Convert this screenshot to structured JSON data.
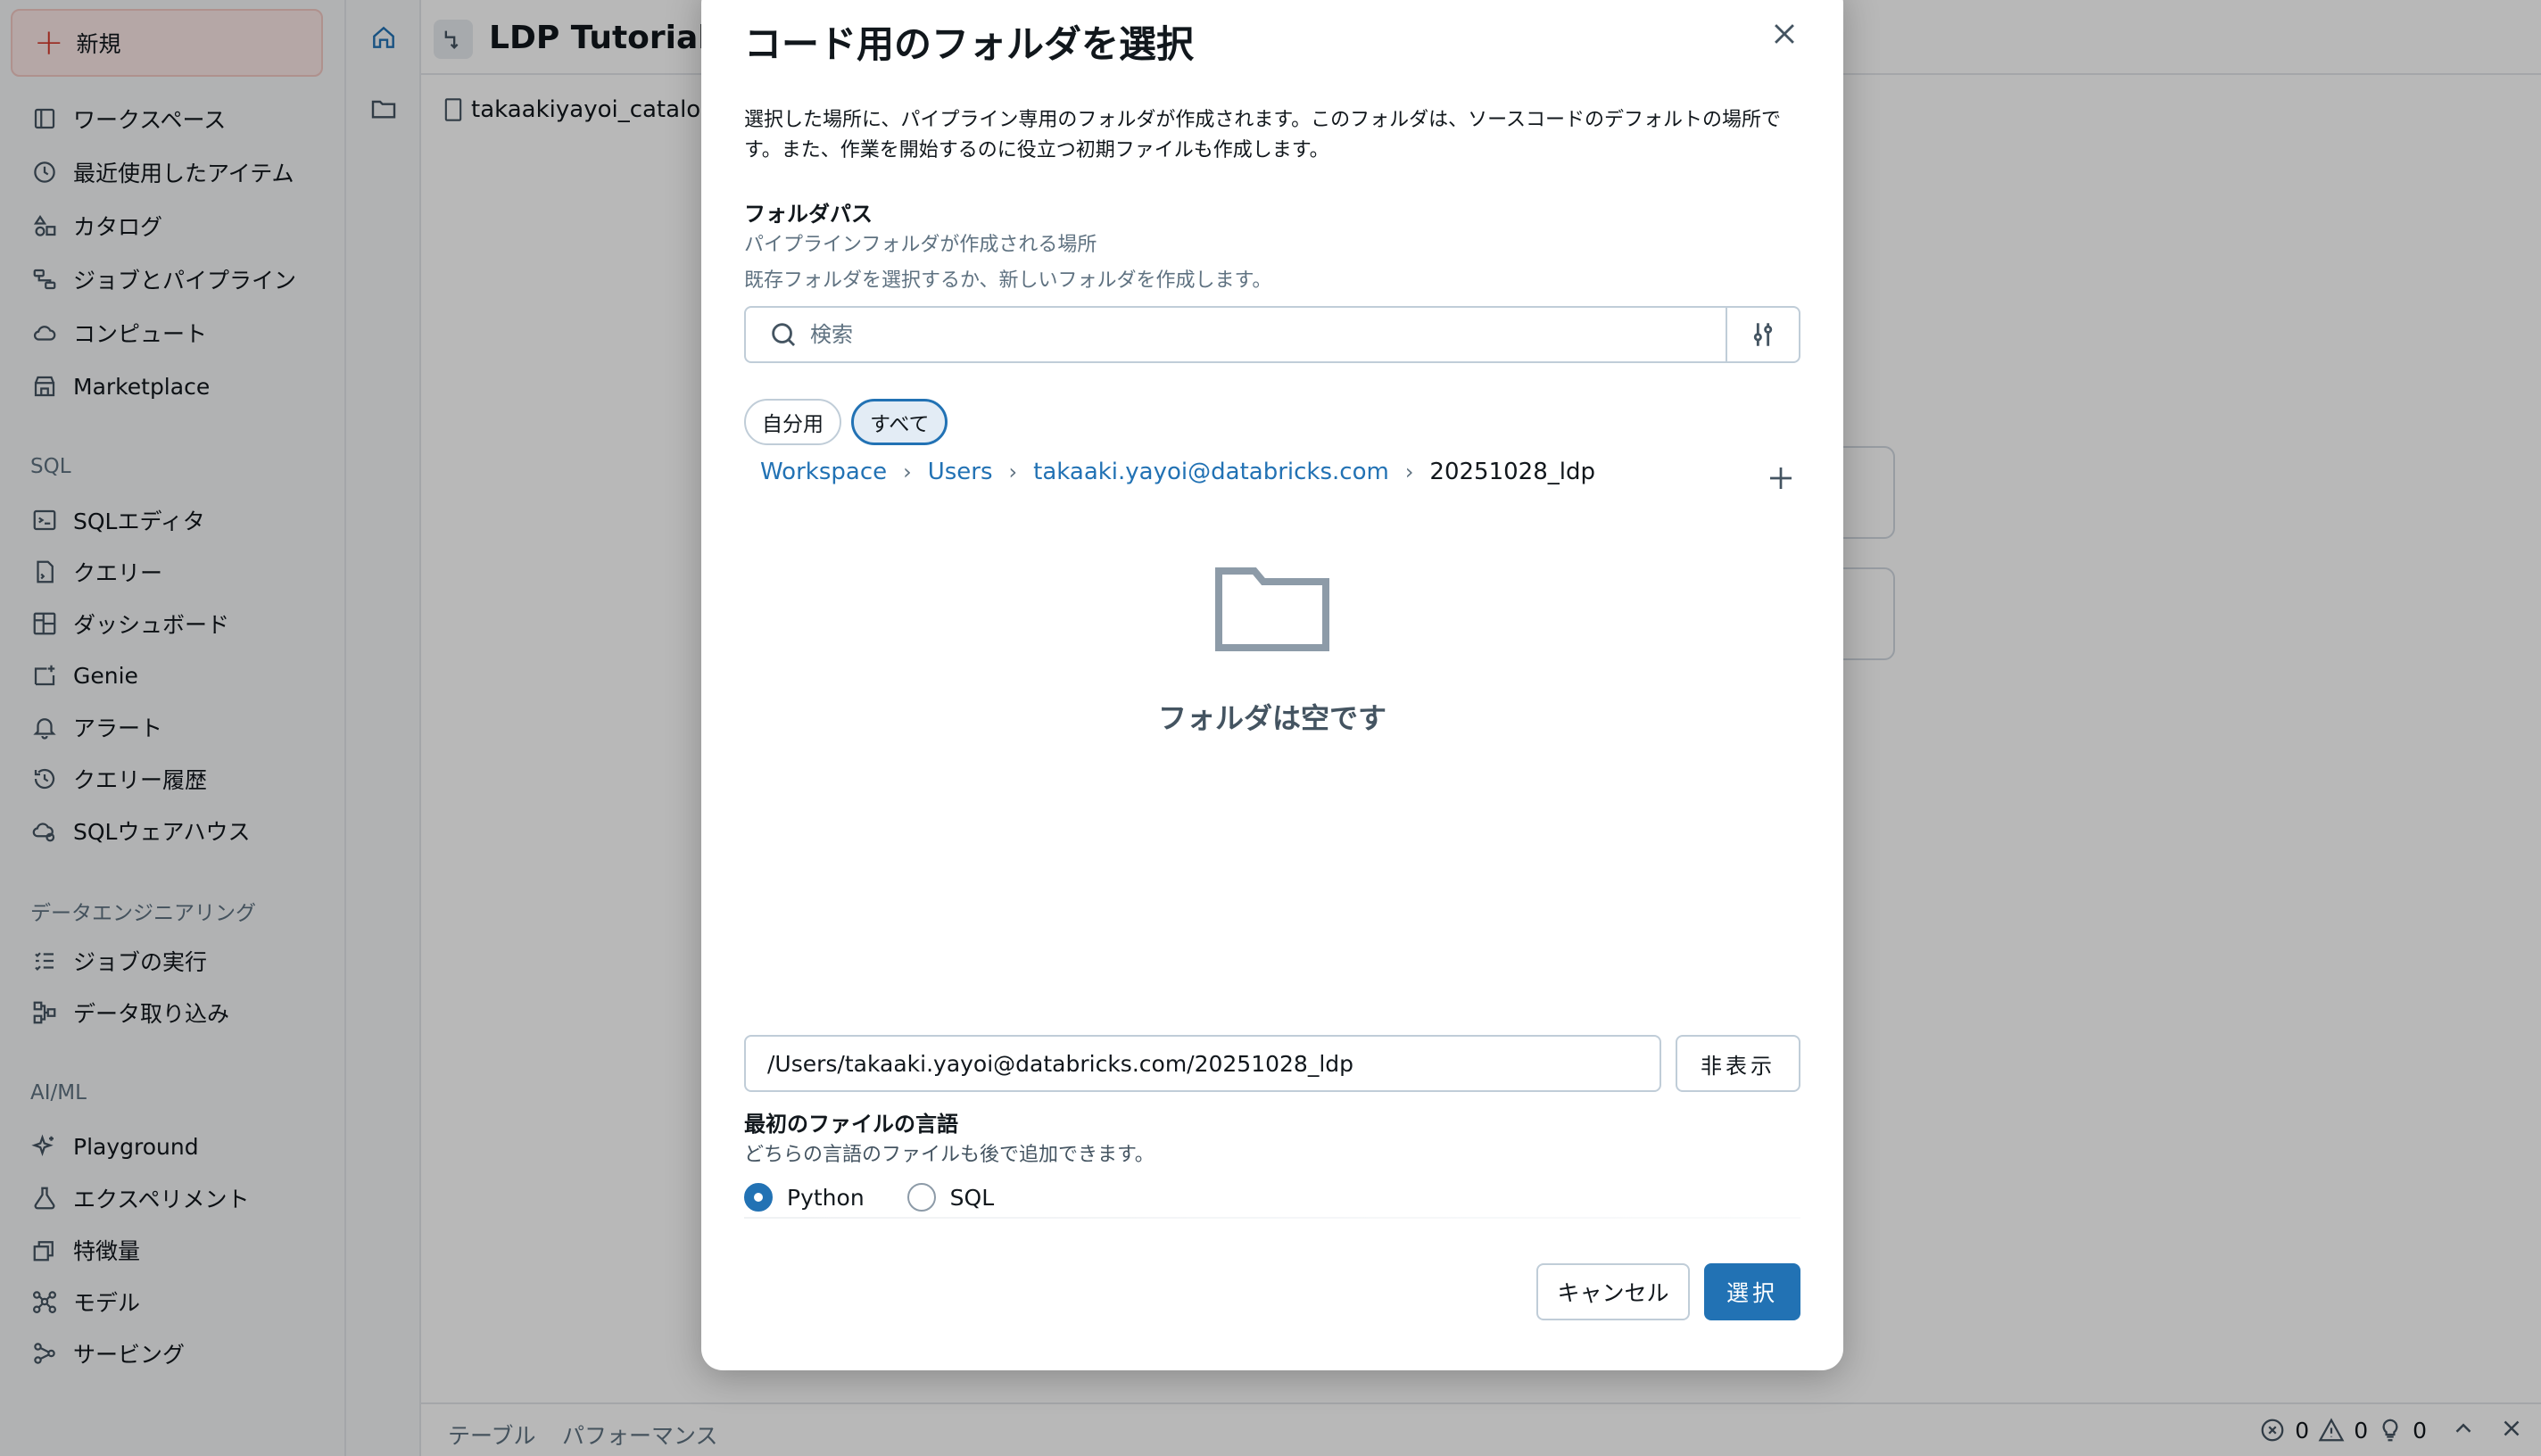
{
  "sidebar": {
    "new_label": "新規",
    "items": [
      {
        "label": "ワークスペース",
        "icon": "workspace-icon"
      },
      {
        "label": "最近使用したアイテム",
        "icon": "clock-icon"
      },
      {
        "label": "カタログ",
        "icon": "catalog-icon"
      },
      {
        "label": "ジョブとパイプライン",
        "icon": "workflows-icon"
      },
      {
        "label": "コンピュート",
        "icon": "cloud-icon"
      },
      {
        "label": "Marketplace",
        "icon": "store-icon"
      }
    ],
    "sql_section": "SQL",
    "sql_items": [
      {
        "label": "SQLエディタ",
        "icon": "sql-editor-icon"
      },
      {
        "label": "クエリー",
        "icon": "query-icon"
      },
      {
        "label": "ダッシュボード",
        "icon": "dashboard-icon"
      },
      {
        "label": "Genie",
        "icon": "genie-icon"
      },
      {
        "label": "アラート",
        "icon": "bell-icon"
      },
      {
        "label": "クエリー履歴",
        "icon": "history-icon"
      },
      {
        "label": "SQLウェアハウス",
        "icon": "warehouse-icon"
      }
    ],
    "de_section": "データエンジニアリング",
    "de_items": [
      {
        "label": "ジョブの実行",
        "icon": "job-runs-icon"
      },
      {
        "label": "データ取り込み",
        "icon": "ingestion-icon"
      }
    ],
    "ml_section": "AI/ML",
    "ml_items": [
      {
        "label": "Playground",
        "icon": "sparkle-icon"
      },
      {
        "label": "エクスペリメント",
        "icon": "beaker-icon"
      },
      {
        "label": "特徴量",
        "icon": "features-icon"
      },
      {
        "label": "モデル",
        "icon": "models-icon"
      },
      {
        "label": "サービング",
        "icon": "serving-icon"
      }
    ]
  },
  "page": {
    "title": "LDP Tutorial",
    "catalog_item": "takaakiyayoi_catalog.",
    "bottom_tabs": [
      "テーブル",
      "パフォーマンス"
    ],
    "status": {
      "errors": "0",
      "warnings": "0",
      "hints": "0"
    }
  },
  "modal": {
    "title": "コード用のフォルダを選択",
    "description": "選択した場所に、パイプライン専用のフォルダが作成されます。このフォルダは、ソースコードのデフォルトの場所です。また、作業を開始するのに役立つ初期ファイルも作成します。",
    "folder_path_label": "フォルダパス",
    "folder_path_hint": "パイプラインフォルダが作成される場所",
    "folder_path_hint2": "既存フォルダを選択するか、新しいフォルダを作成します。",
    "search_placeholder": "検索",
    "filters": [
      "自分用",
      "すべて"
    ],
    "active_filter": "すべて",
    "breadcrumb": [
      "Workspace",
      "Users",
      "takaaki.yayoi@databricks.com",
      "20251028_ldp"
    ],
    "empty_text": "フォルダは空です",
    "path_value": "/Users/takaaki.yayoi@databricks.com/20251028_ldp",
    "hide_label": "非表示",
    "language_label": "最初のファイルの言語",
    "language_hint": "どちらの言語のファイルも後で追加できます。",
    "languages": [
      "Python",
      "SQL"
    ],
    "selected_language": "Python",
    "cancel_label": "キャンセル",
    "select_label": "選択"
  },
  "colors": {
    "accent": "#2272b4",
    "new_button_bg": "#fbe8e6",
    "new_button_icon": "#d6382a"
  }
}
